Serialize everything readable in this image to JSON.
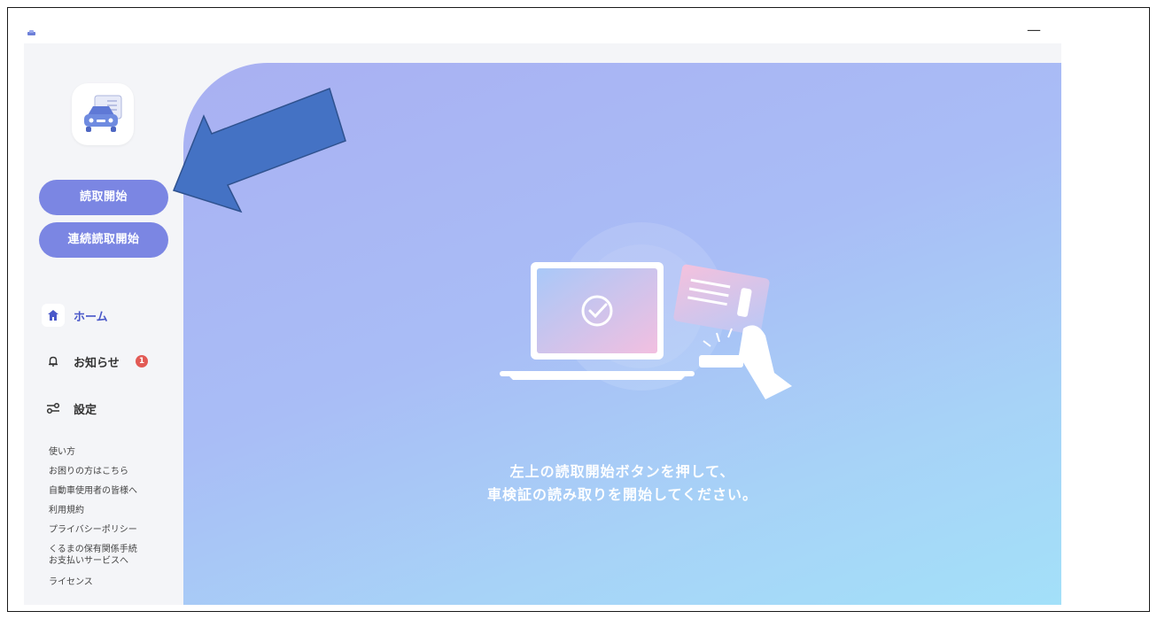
{
  "window": {
    "minimize_label": "—"
  },
  "sidebar": {
    "start_button": "読取開始",
    "continuous_button": "連続読取開始",
    "nav": [
      {
        "label": "ホーム",
        "icon": "home-icon"
      },
      {
        "label": "お知らせ",
        "icon": "bell-icon",
        "badge": "1"
      },
      {
        "label": "設定",
        "icon": "settings-sliders-icon"
      }
    ],
    "links": [
      "使い方",
      "お困りの方はこちら",
      "自動車使用者の皆様へ",
      "利用規約",
      "プライバシーポリシー",
      "くるまの保有関係手続",
      "お支払いサービスへ",
      "ライセンス"
    ]
  },
  "main": {
    "message_line1": "左上の読取開始ボタンを押して、",
    "message_line2": "車検証の読み取りを開始してください。"
  },
  "colors": {
    "accent": "#7b86e3",
    "badge": "#e25a55",
    "arrow": "#4472c4"
  }
}
